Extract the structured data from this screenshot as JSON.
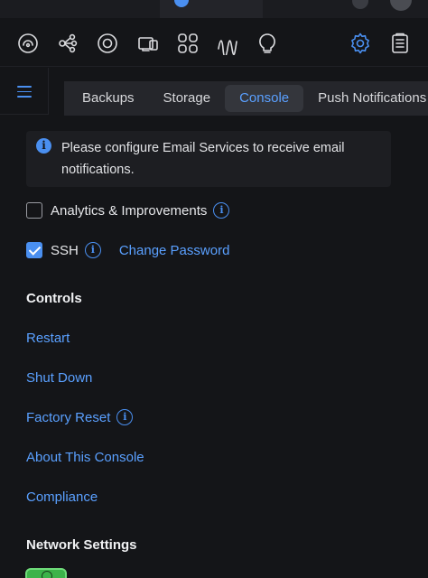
{
  "tabs": [
    {
      "label": "Backups",
      "active": false
    },
    {
      "label": "Storage",
      "active": false
    },
    {
      "label": "Console",
      "active": true
    },
    {
      "label": "Push Notifications",
      "active": false
    }
  ],
  "banner": {
    "message": "Please configure Email Services to receive email notifications."
  },
  "options": {
    "analytics": {
      "label": "Analytics & Improvements",
      "checked": false
    },
    "ssh": {
      "label": "SSH",
      "checked": true,
      "change_password": "Change Password"
    }
  },
  "controls": {
    "heading": "Controls",
    "restart": "Restart",
    "shutdown": "Shut Down",
    "factory_reset": "Factory Reset",
    "about": "About This Console",
    "compliance": "Compliance"
  },
  "network": {
    "heading": "Network Settings"
  },
  "icons": [
    "dashboard-icon",
    "topology-icon",
    "devices-icon",
    "clients-icon",
    "insights-icon",
    "statistics-icon",
    "alerts-icon",
    "settings-icon",
    "logs-icon"
  ],
  "colors": {
    "accent": "#4a8ff0",
    "background": "#141518",
    "success": "#3db34a"
  }
}
